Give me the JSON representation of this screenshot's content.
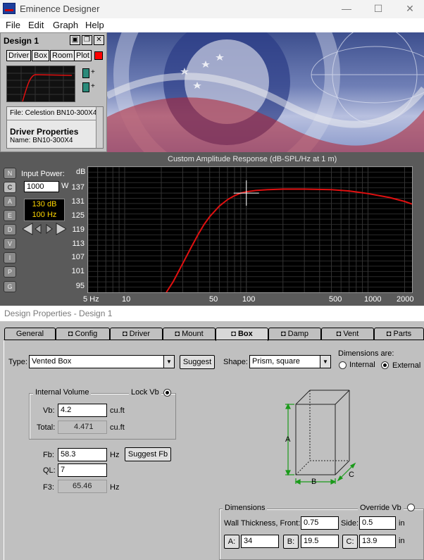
{
  "window": {
    "title": "Eminence Designer",
    "minimize": "—",
    "maximize": "☐",
    "close": "✕"
  },
  "menu": [
    "File",
    "Edit",
    "Graph",
    "Help"
  ],
  "design_window": {
    "title": "Design 1",
    "tabs": [
      "Driver",
      "Box",
      "Room",
      "Plot"
    ],
    "file_line": "File: Celestion BN10-300X4 (",
    "driver_props": "Driver Properties",
    "name_line": "Name: BN10-300X4"
  },
  "graph": {
    "title": "Custom Amplitude Response (dB-SPL/Hz at 1 m)",
    "side_buttons": [
      "N",
      "C",
      "A",
      "E",
      "D",
      "V",
      "I",
      "P",
      "G"
    ],
    "input_power_label": "Input Power:",
    "input_power_value": "1000",
    "input_power_unit": "W",
    "readout_db": "130 dB",
    "readout_hz": "100 Hz",
    "y_unit": "dB",
    "y_ticks": [
      "137",
      "131",
      "125",
      "119",
      "113",
      "107",
      "101",
      "95"
    ],
    "x_ticks": [
      "5 Hz",
      "10",
      "50",
      "100",
      "500",
      "1000",
      "2000"
    ]
  },
  "chart_data": {
    "type": "line",
    "title": "Custom Amplitude Response (dB-SPL/Hz at 1 m)",
    "xlabel": "",
    "ylabel": "dB",
    "x_scale": "log",
    "xlim": [
      5,
      2300
    ],
    "ylim": [
      92,
      140
    ],
    "series": [
      {
        "color": "#e01010",
        "x": [
          22,
          25,
          30,
          35,
          40,
          45,
          50,
          60,
          70,
          80,
          90,
          100,
          120,
          150,
          200,
          300,
          500,
          700,
          1000,
          1500,
          2000,
          2300
        ],
        "y": [
          92,
          96,
          103,
          109,
          114,
          118,
          121,
          125,
          127.5,
          129,
          130,
          130.5,
          131,
          131.3,
          131.5,
          131.5,
          131.3,
          130.8,
          129.8,
          128.3,
          126.8,
          125.8
        ]
      }
    ]
  },
  "props": {
    "title": "Design Properties - Design 1",
    "tabs": [
      "General",
      "Config",
      "Driver",
      "Mount",
      "Box",
      "Damp",
      "Vent",
      "Parts"
    ],
    "active_tab": "Box",
    "type_label": "Type:",
    "type_value": "Vented Box",
    "suggest_label": "Suggest",
    "shape_label": "Shape:",
    "shape_value": "Prism, square",
    "dims_are_label": "Dimensions are:",
    "internal_label": "Internal",
    "external_label": "External",
    "internal_volume_label": "Internal Volume",
    "lock_vb_label": "Lock Vb",
    "vb_label": "Vb:",
    "vb_value": "4.2",
    "vb_unit": "cu.ft",
    "total_label": "Total:",
    "total_value": "4.471",
    "total_unit": "cu.ft",
    "fb_label": "Fb:",
    "fb_value": "58.3",
    "fb_unit": "Hz",
    "suggest_fb_label": "Suggest Fb",
    "ql_label": "QL:",
    "ql_value": "7",
    "f3_label": "F3:",
    "f3_value": "65.46",
    "f3_unit": "Hz",
    "diagram_a": "A",
    "diagram_b": "B",
    "diagram_c": "C",
    "dimensions_label": "Dimensions",
    "override_vb_label": "Override Vb",
    "wall_label": "Wall Thickness, Front:",
    "wall_value": "0.75",
    "side_label": "Side:",
    "side_value": "0.5",
    "side_unit": "in",
    "a_label": "A:",
    "a_value": "34",
    "b_label": "B:",
    "b_value": "19.5",
    "c_label": "C:",
    "c_value": "13.9",
    "c_unit": "in"
  }
}
